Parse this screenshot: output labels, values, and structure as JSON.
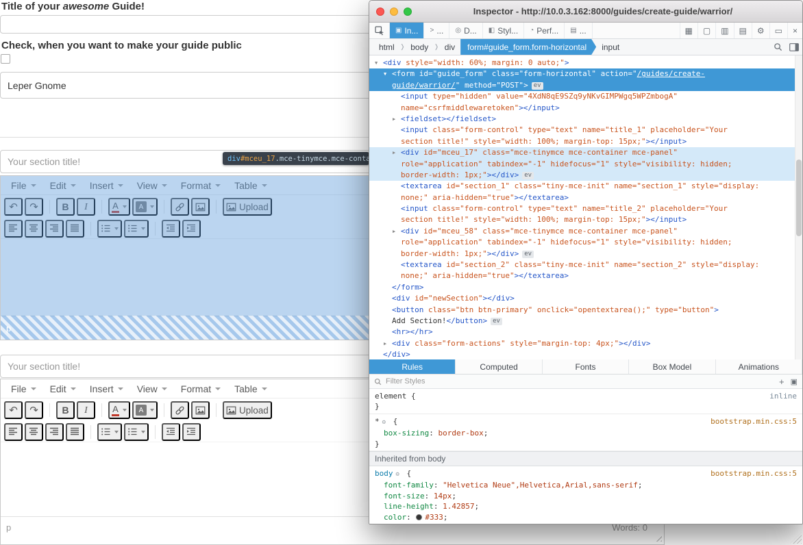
{
  "page": {
    "heading": {
      "pre": "Title of your ",
      "em": "awesome",
      "post": " Guide!"
    },
    "public_checkbox_label": "Check, when you want to make your guide public",
    "guide_title_value": "Leper Gnome",
    "section_title_placeholder": "Your section title!",
    "editor_menus": [
      "File",
      "Edit",
      "Insert",
      "View",
      "Format",
      "Table"
    ],
    "toolbar_row1": [
      "undo",
      "redo",
      "sep",
      "bold",
      "italic",
      "sep",
      "forecolor",
      "backcolor",
      "sep",
      "link",
      "image",
      "sep",
      "upload"
    ],
    "toolbar_row2": [
      "align-left",
      "align-center",
      "align-right",
      "align-justify",
      "sep",
      "bullist",
      "numlist",
      "sep",
      "outdent",
      "indent"
    ],
    "upload_label": "Upload",
    "status_path": "p",
    "word_count": "Words: 0"
  },
  "tooltip": {
    "tag": "div",
    "id": "#mceu_17",
    "classes": ".mce-tinymce.mce-container.m"
  },
  "devtools": {
    "window_title": "Inspector - http://10.0.3.162:8000/guides/create-guide/warrior/",
    "toolbar_tabs": [
      {
        "id": "inspector",
        "label": "In...",
        "active": true
      },
      {
        "id": "console",
        "label": "..."
      },
      {
        "id": "debugger",
        "label": "D..."
      },
      {
        "id": "style-editor",
        "label": "Styl..."
      },
      {
        "id": "performance",
        "label": "Perf..."
      },
      {
        "id": "more-tools",
        "label": "..."
      }
    ],
    "toolbar_right_icons": [
      "frames",
      "doc",
      "book",
      "clipboard",
      "settings",
      "dock",
      "close"
    ],
    "breadcrumbs": [
      {
        "label": "html"
      },
      {
        "label": "body"
      },
      {
        "label": "div"
      },
      {
        "label": "form#guide_form.form-horizontal",
        "selected": true
      },
      {
        "label": "input"
      }
    ],
    "markup_lines": [
      {
        "i": 0,
        "g": [
          [
            "ad"
          ],
          [
            "t",
            "<div"
          ],
          [
            "a",
            " style=\"width: 60%; margin: 0 auto;\""
          ],
          [
            "t",
            ">"
          ]
        ]
      },
      {
        "i": 1,
        "s": "sel",
        "g": [
          [
            "ad"
          ],
          [
            "t",
            "<form"
          ],
          [
            "a",
            " id=\"guide_form\" class=\"form-horizontal\" action=\""
          ],
          [
            "l",
            "/guides/create-"
          ]
        ]
      },
      {
        "i": 1,
        "s": "sel",
        "g": [
          [
            "l",
            "guide/warrior/"
          ],
          [
            "a",
            "\" method=\"POST\""
          ],
          [
            "t",
            ">"
          ],
          [
            "ev",
            "ev"
          ]
        ]
      },
      {
        "i": 2,
        "g": [
          [
            "t",
            "<input"
          ],
          [
            "a",
            " type=\"hidden\" value=\"4XdN8qE9SZq9yNKvGIMPWgq5WPZmbogA\""
          ]
        ]
      },
      {
        "i": 2,
        "g": [
          [
            "a",
            "name=\"csrfmiddlewaretoken\""
          ],
          [
            "t",
            "></input>"
          ]
        ]
      },
      {
        "i": 2,
        "g": [
          [
            "ar"
          ],
          [
            "t",
            "<fieldset></fieldset>"
          ]
        ]
      },
      {
        "i": 2,
        "g": [
          [
            "t",
            "<input"
          ],
          [
            "a",
            " class=\"form-control\" type=\"text\" name=\"title_1\" placeholder=\"Your"
          ]
        ]
      },
      {
        "i": 2,
        "g": [
          [
            "a",
            "section title!\" style=\"width: 100%; margin-top: 15px;\""
          ],
          [
            "t",
            "></input>"
          ]
        ]
      },
      {
        "i": 2,
        "s": "hov",
        "g": [
          [
            "ar"
          ],
          [
            "t",
            "<div"
          ],
          [
            "a",
            " id=\"mceu_17\" class=\"mce-tinymce mce-container mce-panel\""
          ]
        ]
      },
      {
        "i": 2,
        "s": "hov",
        "g": [
          [
            "a",
            "role=\"application\" tabindex=\"-1\" hidefocus=\"1\" style=\"visibility: hidden;"
          ]
        ]
      },
      {
        "i": 2,
        "s": "hov",
        "g": [
          [
            "a",
            "border-width: 1px;\""
          ],
          [
            "t",
            "></div>"
          ],
          [
            "ev",
            "ev"
          ]
        ]
      },
      {
        "i": 2,
        "g": [
          [
            "t",
            "<textarea"
          ],
          [
            "a",
            " id=\"section_1\" class=\"tiny-mce-init\" name=\"section_1\" style=\"display:"
          ]
        ]
      },
      {
        "i": 2,
        "g": [
          [
            "a",
            "none;\" aria-hidden=\"true\""
          ],
          [
            "t",
            "></textarea>"
          ]
        ]
      },
      {
        "i": 2,
        "g": [
          [
            "t",
            "<input"
          ],
          [
            "a",
            " class=\"form-control\" type=\"text\" name=\"title_2\" placeholder=\"Your"
          ]
        ]
      },
      {
        "i": 2,
        "g": [
          [
            "a",
            "section title!\" style=\"width: 100%; margin-top: 15px;\""
          ],
          [
            "t",
            "></input>"
          ]
        ]
      },
      {
        "i": 2,
        "g": [
          [
            "ar"
          ],
          [
            "t",
            "<div"
          ],
          [
            "a",
            " id=\"mceu_58\" class=\"mce-tinymce mce-container mce-panel\""
          ]
        ]
      },
      {
        "i": 2,
        "g": [
          [
            "a",
            "role=\"application\" tabindex=\"-1\" hidefocus=\"1\" style=\"visibility: hidden;"
          ]
        ]
      },
      {
        "i": 2,
        "g": [
          [
            "a",
            "border-width: 1px;\""
          ],
          [
            "t",
            "></div>"
          ],
          [
            "ev",
            "ev"
          ]
        ]
      },
      {
        "i": 2,
        "g": [
          [
            "t",
            "<textarea"
          ],
          [
            "a",
            " id=\"section_2\" class=\"tiny-mce-init\" name=\"section_2\" style=\"display:"
          ]
        ]
      },
      {
        "i": 2,
        "g": [
          [
            "a",
            "none;\" aria-hidden=\"true\""
          ],
          [
            "t",
            "></textarea>"
          ]
        ]
      },
      {
        "i": 1,
        "g": [
          [
            "t",
            "</form>"
          ]
        ]
      },
      {
        "i": 1,
        "g": [
          [
            "t",
            "<div"
          ],
          [
            "a",
            " id=\"newSection\""
          ],
          [
            "t",
            "></div>"
          ]
        ]
      },
      {
        "i": 1,
        "g": [
          [
            "t",
            "<button"
          ],
          [
            "a",
            " class=\"btn btn-primary\" onclick=\"opentextarea();\" type=\"button\""
          ],
          [
            "t",
            ">"
          ]
        ]
      },
      {
        "i": 1,
        "g": [
          [
            "x",
            "Add Section!"
          ],
          [
            "t",
            "</button>"
          ],
          [
            "ev",
            "ev"
          ]
        ]
      },
      {
        "i": 1,
        "g": [
          [
            "t",
            "<hr></hr>"
          ]
        ]
      },
      {
        "i": 1,
        "g": [
          [
            "ar"
          ],
          [
            "t",
            "<div"
          ],
          [
            "a",
            " class=\"form-actions\" style=\"margin-top: 4px;\""
          ],
          [
            "t",
            "></div>"
          ]
        ]
      },
      {
        "i": 0,
        "g": [
          [
            "t",
            "</div>"
          ]
        ]
      }
    ],
    "sidebar_tabs": [
      {
        "label": "Rules",
        "active": true
      },
      {
        "label": "Computed"
      },
      {
        "label": "Fonts"
      },
      {
        "label": "Box Model"
      },
      {
        "label": "Animations"
      }
    ],
    "filter_placeholder": "Filter Styles",
    "rule_sections": [
      {
        "header": null,
        "rules": [
          {
            "selector": "element",
            "source": "inline",
            "icon": false,
            "declarations": []
          },
          {
            "selector": "*",
            "source": "bootstrap.min.css:5",
            "icon": true,
            "declarations": [
              {
                "prop": "box-sizing",
                "value": "border-box"
              }
            ]
          }
        ]
      },
      {
        "header": "Inherited from body",
        "rules": [
          {
            "selector": "body",
            "source": "bootstrap.min.css:5",
            "icon": true,
            "declarations": [
              {
                "prop": "font-family",
                "value": "\"Helvetica Neue\",Helvetica,Arial,sans-serif"
              },
              {
                "prop": "font-size",
                "value": "14px"
              },
              {
                "prop": "line-height",
                "value": "1.42857"
              },
              {
                "prop": "color",
                "value": "#333",
                "swatch": "#333"
              }
            ]
          }
        ]
      }
    ]
  }
}
